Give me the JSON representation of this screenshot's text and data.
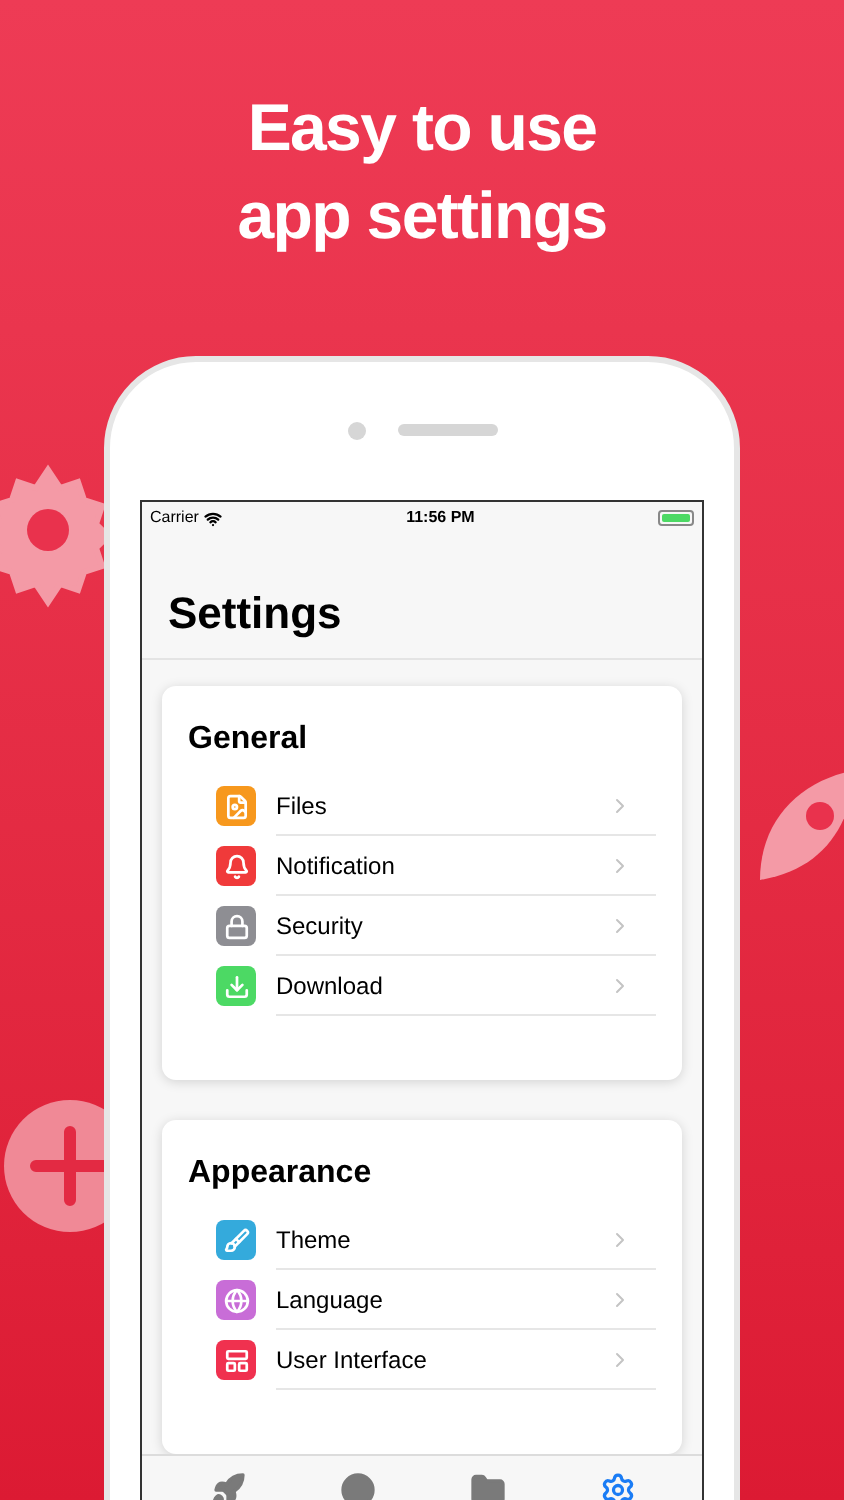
{
  "headline": [
    "Easy to use",
    "app settings"
  ],
  "status_bar": {
    "carrier": "Carrier",
    "time": "11:56 PM"
  },
  "title": "Settings",
  "sections": [
    {
      "title": "General",
      "items": [
        {
          "label": "Files",
          "color": "#f7981d"
        },
        {
          "label": "Notification",
          "color": "#f03a3a"
        },
        {
          "label": "Security",
          "color": "#8e8e93"
        },
        {
          "label": "Download",
          "color": "#4cd964"
        }
      ]
    },
    {
      "title": "Appearance",
      "items": [
        {
          "label": "Theme",
          "color": "#34aadc"
        },
        {
          "label": "Language",
          "color": "#c86dd7"
        },
        {
          "label": "User Interface",
          "color": "#f0314f"
        }
      ]
    }
  ],
  "tab_bar": [
    {
      "selected": false
    },
    {
      "selected": false
    },
    {
      "selected": false
    },
    {
      "selected": true
    }
  ]
}
